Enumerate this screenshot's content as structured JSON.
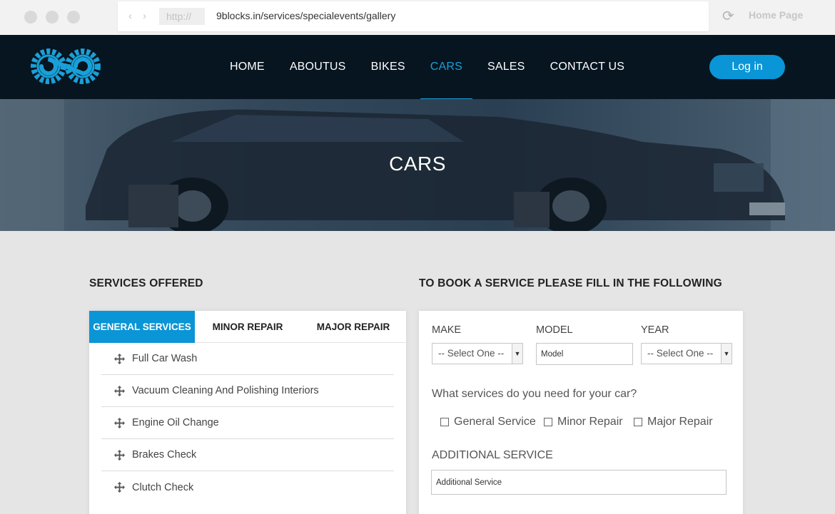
{
  "browser": {
    "protocol": "http://",
    "url": "9blocks.in/services/specialevents/gallery",
    "home_page_label": "Home Page"
  },
  "header": {
    "nav": [
      "HOME",
      "ABOUTUS",
      "BIKES",
      "CARS",
      "SALES",
      "CONTACT US"
    ],
    "active_nav": "CARS",
    "login_label": "Log in",
    "brand_color": "#0a95d6"
  },
  "hero": {
    "title": "CARS"
  },
  "services": {
    "heading": "SERVICES OFFERED",
    "tabs": [
      "GENERAL SERVICES",
      "MINOR REPAIR",
      "MAJOR REPAIR"
    ],
    "active_tab": "GENERAL SERVICES",
    "items": [
      "Full Car Wash",
      "Vacuum Cleaning And Polishing Interiors",
      "Engine Oil Change",
      "Brakes Check",
      "Clutch Check"
    ]
  },
  "booking": {
    "heading": "TO BOOK A SERVICE PLEASE FILL IN THE FOLLOWING",
    "make_label": "MAKE",
    "make_value": "-- Select One --",
    "model_label": "MODEL",
    "model_value": "Model",
    "year_label": "YEAR",
    "year_value": "-- Select One --",
    "question": "What services do you need for your car?",
    "options": [
      "General Service",
      "Minor Repair",
      "Major Repair"
    ],
    "additional_label": "ADDITIONAL SERVICE",
    "additional_value": "Additional Service"
  }
}
